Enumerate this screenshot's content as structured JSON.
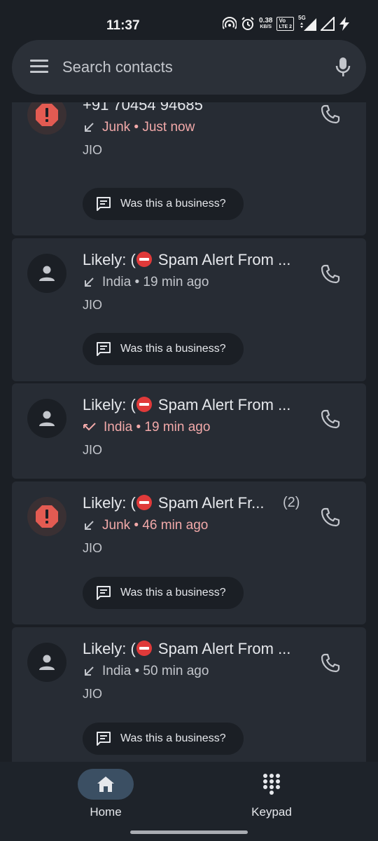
{
  "status_bar": {
    "time": "11:37",
    "speed_value": "0.38",
    "speed_unit": "KB/S",
    "volte_top": "Vo",
    "volte_bottom": "LTE 2",
    "network": "5G"
  },
  "search": {
    "placeholder": "Search contacts"
  },
  "calls": [
    {
      "name": "+91 70454 94685",
      "name_parts": [
        "+91 70454 94685",
        ""
      ],
      "has_spam_emoji": false,
      "avatar": "spam",
      "direction": "incoming",
      "label": "Junk",
      "time": "Just now",
      "detail": "Junk • Just now",
      "detail_color": "red",
      "carrier": "JIO",
      "count": "",
      "business_prompt": "Was this a business?"
    },
    {
      "name_parts": [
        "Likely: (",
        " Spam Alert From ..."
      ],
      "has_spam_emoji": true,
      "avatar": "person",
      "direction": "incoming",
      "detail": "India • 19 min ago",
      "detail_color": "normal",
      "carrier": "JIO",
      "count": "",
      "business_prompt": "Was this a business?"
    },
    {
      "name_parts": [
        "Likely: (",
        " Spam Alert From ..."
      ],
      "has_spam_emoji": true,
      "avatar": "person",
      "direction": "missed",
      "detail": "India • 19 min ago",
      "detail_color": "red",
      "carrier": "JIO",
      "count": ""
    },
    {
      "name_parts": [
        "Likely: (",
        " Spam Alert Fr..."
      ],
      "has_spam_emoji": true,
      "avatar": "spam",
      "direction": "incoming",
      "detail": "Junk • 46 min ago",
      "detail_color": "red",
      "carrier": "JIO",
      "count": "(2)",
      "business_prompt": "Was this a business?"
    },
    {
      "name_parts": [
        "Likely: (",
        " Spam Alert From ..."
      ],
      "has_spam_emoji": true,
      "avatar": "person",
      "direction": "incoming",
      "detail": "India • 50 min ago",
      "detail_color": "normal",
      "carrier": "JIO",
      "count": "",
      "business_prompt": "Was this a business?"
    }
  ],
  "nav": {
    "home_label": "Home",
    "keypad_label": "Keypad",
    "active": "home"
  },
  "colors": {
    "background": "#1b1f25",
    "card": "#272c34",
    "spam_red": "#e35b52",
    "junk_text": "#f2a9a9",
    "active_pill": "#3b4f63"
  }
}
